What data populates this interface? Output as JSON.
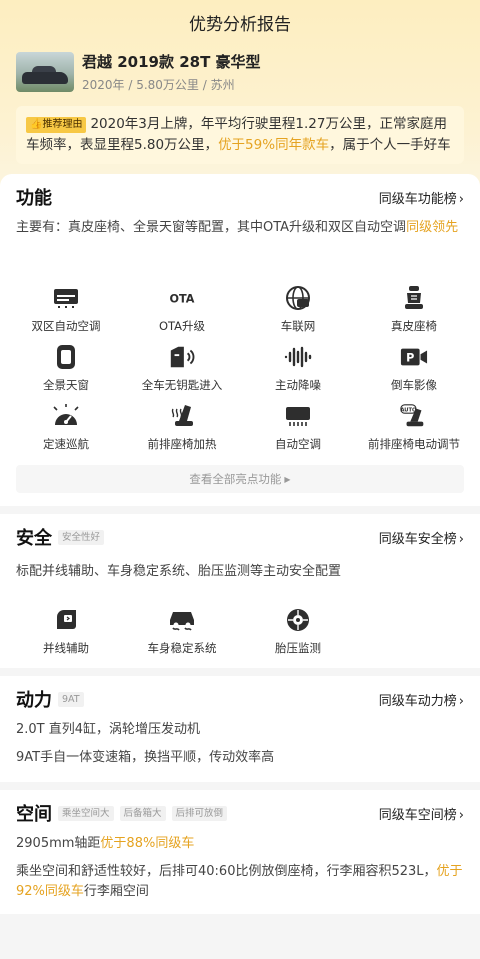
{
  "header": {
    "title": "优势分析报告"
  },
  "car": {
    "name": "君越 2019款 28T 豪华型",
    "meta": "2020年 / 5.80万公里 / 苏州"
  },
  "reason": {
    "tag": "推荐理由",
    "text_pre": "2020年3月上牌，年平均行驶里程1.27万公里，正常家庭用车频率，表显里程5.80万公里，",
    "text_hl": "优于59%同年款车",
    "text_post": "，属于个人一手好车"
  },
  "features": {
    "title": "功能",
    "rank_link": "同级车功能榜",
    "desc_pre": "主要有：真皮座椅、全景天窗等配置，其中OTA升级和双区自动空调",
    "desc_hl": "同级领先",
    "items": [
      {
        "label": "双区自动空调",
        "icon": "dual-zone-ac-icon"
      },
      {
        "label": "OTA升级",
        "icon": "ota-icon"
      },
      {
        "label": "车联网",
        "icon": "connected-car-icon"
      },
      {
        "label": "真皮座椅",
        "icon": "leather-seat-icon"
      },
      {
        "label": "全景天窗",
        "icon": "panoramic-sunroof-icon"
      },
      {
        "label": "全车无钥匙进入",
        "icon": "keyless-entry-icon"
      },
      {
        "label": "主动降噪",
        "icon": "noise-cancel-icon"
      },
      {
        "label": "倒车影像",
        "icon": "reverse-camera-icon"
      },
      {
        "label": "定速巡航",
        "icon": "cruise-control-icon"
      },
      {
        "label": "前排座椅加热",
        "icon": "seat-heating-icon"
      },
      {
        "label": "自动空调",
        "icon": "auto-ac-icon"
      },
      {
        "label": "前排座椅电动调节",
        "icon": "power-seat-icon"
      }
    ],
    "more_label": "查看全部亮点功能"
  },
  "safety": {
    "title": "安全",
    "tag": "安全性好",
    "rank_link": "同级车安全榜",
    "desc": "标配并线辅助、车身稳定系统、胎压监测等主动安全配置",
    "items": [
      {
        "label": "并线辅助",
        "icon": "lane-assist-icon"
      },
      {
        "label": "车身稳定系统",
        "icon": "stability-control-icon"
      },
      {
        "label": "胎压监测",
        "icon": "tire-pressure-icon"
      }
    ]
  },
  "power": {
    "title": "动力",
    "tag": "9AT",
    "rank_link": "同级车动力榜",
    "line1": "2.0T 直列4缸，涡轮增压发动机",
    "line2": "9AT手自一体变速箱，换挡平顺，传动效率高"
  },
  "space": {
    "title": "空间",
    "tags": [
      "乘坐空间大",
      "后备箱大",
      "后排可放倒"
    ],
    "rank_link": "同级车空间榜",
    "line1_pre": "2905mm轴距",
    "line1_hl": "优于88%同级车",
    "line2_pre": "乘坐空间和舒适性较好，后排可40:60比例放倒座椅，行李厢容积523L，",
    "line2_hl": "优于92%同级车",
    "line2_post": "行李厢空间"
  },
  "colors": {
    "accent": "#e5a321",
    "tag_bg": "#f7c845",
    "header_bg": "#fdeec0"
  }
}
